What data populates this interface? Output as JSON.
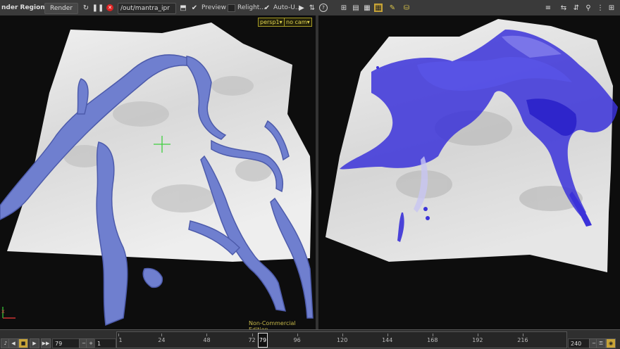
{
  "render_bar": {
    "title": "nder Region",
    "render_label": "Render",
    "output_path": "/out/mantra_ipr",
    "preview_label": "Preview",
    "relight_label": "Relight...",
    "autoupdate_label": "Auto-U..."
  },
  "viewport": {
    "camera_menu": "persp1▾",
    "cam_menu": "no cam▾",
    "watermark": "Non-Commercial Edition",
    "axis_label": "x"
  },
  "timeline": {
    "current_frame": "79",
    "start_frame": "1",
    "end_frame": "240",
    "ticks": [
      "1",
      "24",
      "48",
      "72",
      "96",
      "120",
      "144",
      "168",
      "192",
      "216"
    ],
    "marker": "79"
  },
  "colors": {
    "fluid_left": "#6f7fcf",
    "fluid_right": "#3b32d9",
    "terrain": "#dcdcdc",
    "background": "#0d0d0d"
  }
}
